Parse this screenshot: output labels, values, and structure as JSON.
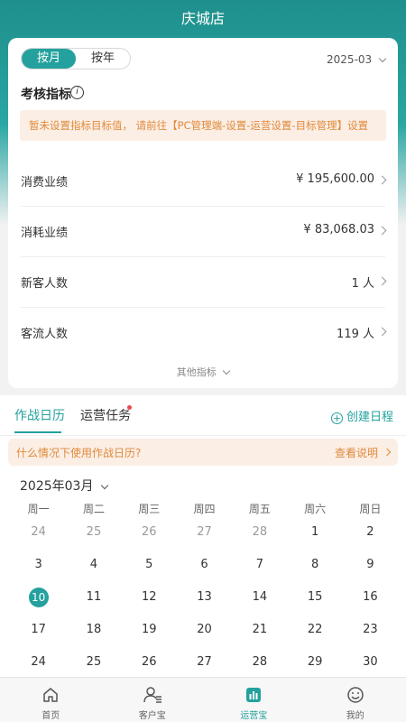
{
  "page": {
    "title": "庆城店"
  },
  "period": {
    "options": [
      "按月",
      "按年"
    ],
    "selected_month": "2025-03"
  },
  "assessment": {
    "title": "考核指标",
    "info_icon": "i",
    "notice": "暂未设置指标目标值， 请前往【PC管理端-设置-运营设置-目标管理】设置",
    "metrics": [
      {
        "label": "消费业绩",
        "value": "¥ 195,600.00"
      },
      {
        "label": "消耗业绩",
        "value": "¥ 83,068.03"
      },
      {
        "label": "新客人数",
        "value": "1 人"
      },
      {
        "label": "客流人数",
        "value": "119 人"
      }
    ],
    "more_label": "其他指标"
  },
  "tabs": {
    "items": [
      "作战日历",
      "运营任务"
    ],
    "create_label": "创建日程",
    "create_icon": "+"
  },
  "help": {
    "question": "什么情况下使用作战日历?",
    "link": "查看说明"
  },
  "calendar": {
    "month_label": "2025年03月",
    "weekdays": [
      "周一",
      "周二",
      "周三",
      "周四",
      "周五",
      "周六",
      "周日"
    ],
    "weeks": [
      [
        "24",
        "25",
        "26",
        "27",
        "28",
        "1",
        "2"
      ],
      [
        "3",
        "4",
        "5",
        "6",
        "7",
        "8",
        "9"
      ],
      [
        "10",
        "11",
        "12",
        "13",
        "14",
        "15",
        "16"
      ],
      [
        "17",
        "18",
        "19",
        "20",
        "21",
        "22",
        "23"
      ],
      [
        "24",
        "25",
        "26",
        "27",
        "28",
        "29",
        "30"
      ]
    ],
    "today": "10"
  },
  "nav": [
    {
      "label": "首页",
      "icon": "home-icon"
    },
    {
      "label": "客户宝",
      "icon": "customer-icon"
    },
    {
      "label": "运营宝",
      "icon": "chart-icon"
    },
    {
      "label": "我的",
      "icon": "smile-icon"
    }
  ],
  "colors": {
    "accent": "#24a19e",
    "notice": "#e08a3a",
    "notice_bg": "#fbeee5"
  }
}
